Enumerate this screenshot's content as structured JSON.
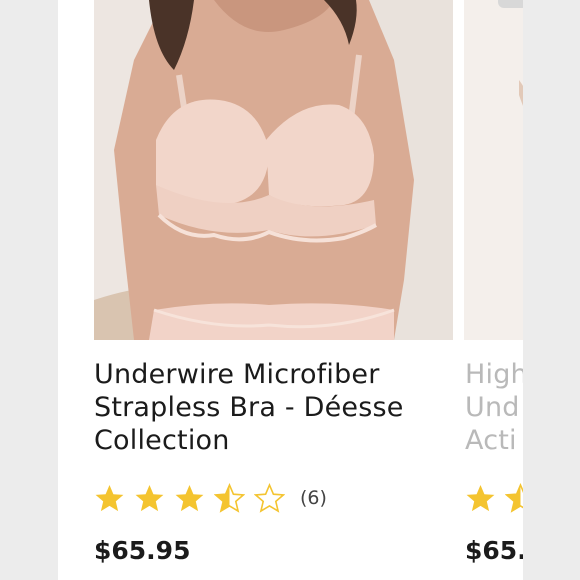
{
  "products": [
    {
      "title": "Underwire Microfiber Strapless Bra - Déesse Collection",
      "rating_value": 3.5,
      "rating_max": 5,
      "rating_count": "(6)",
      "price": "$65.95"
    },
    {
      "title": "High\nUnd\nActi",
      "rating_value": 1.5,
      "rating_max": 5,
      "price": "$65."
    }
  ],
  "colors": {
    "star": "#f4c430",
    "star_empty_stroke": "#f4c430",
    "text": "#1b1b1b",
    "muted_text": "#b9b9b9",
    "page_bg": "#ececec"
  }
}
